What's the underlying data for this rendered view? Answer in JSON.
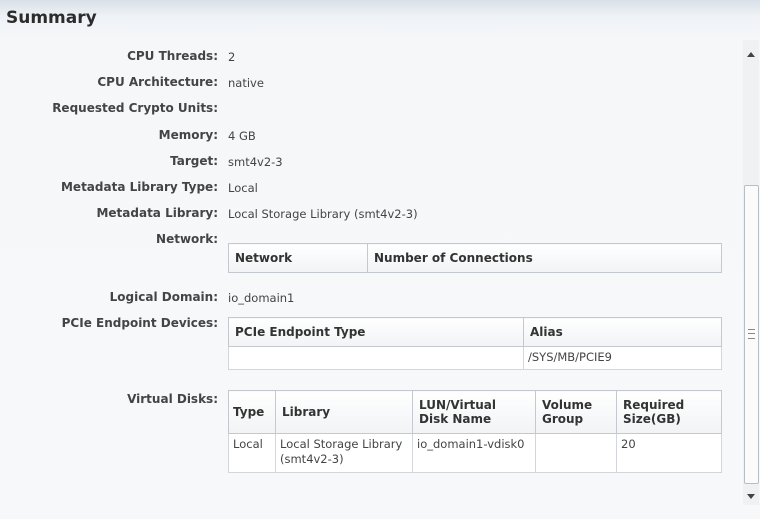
{
  "section_title": "Summary",
  "fields": {
    "cpu_threads": {
      "label": "CPU Threads:",
      "value": "2"
    },
    "cpu_architecture": {
      "label": "CPU Architecture:",
      "value": "native"
    },
    "crypto_units": {
      "label": "Requested Crypto Units:",
      "value": ""
    },
    "memory": {
      "label": "Memory:",
      "value": "4 GB"
    },
    "target": {
      "label": "Target:",
      "value": "smt4v2-3"
    },
    "metadata_library_type": {
      "label": "Metadata Library Type:",
      "value": "Local"
    },
    "metadata_library": {
      "label": "Metadata Library:",
      "value": "Local Storage Library (smt4v2-3)"
    },
    "network": {
      "label": "Network:"
    },
    "logical_domain": {
      "label": "Logical Domain:",
      "value": "io_domain1"
    },
    "pcie_devices": {
      "label": "PCIe Endpoint Devices:"
    },
    "virtual_disks": {
      "label": "Virtual Disks:"
    }
  },
  "network_table": {
    "columns": [
      "Network",
      "Number of Connections"
    ]
  },
  "pcie_table": {
    "columns": [
      "PCIe Endpoint Type",
      "Alias"
    ],
    "rows": [
      [
        "",
        "/SYS/MB/PCIE9"
      ]
    ]
  },
  "vdisk_table": {
    "columns": [
      "Type",
      "Library",
      "LUN/Virtual Disk Name",
      "Volume Group",
      "Required Size(GB)"
    ],
    "rows": [
      [
        "Local",
        "Local Storage Library (smt4v2-3)",
        "io_domain1-vdisk0",
        "",
        "20"
      ]
    ]
  }
}
